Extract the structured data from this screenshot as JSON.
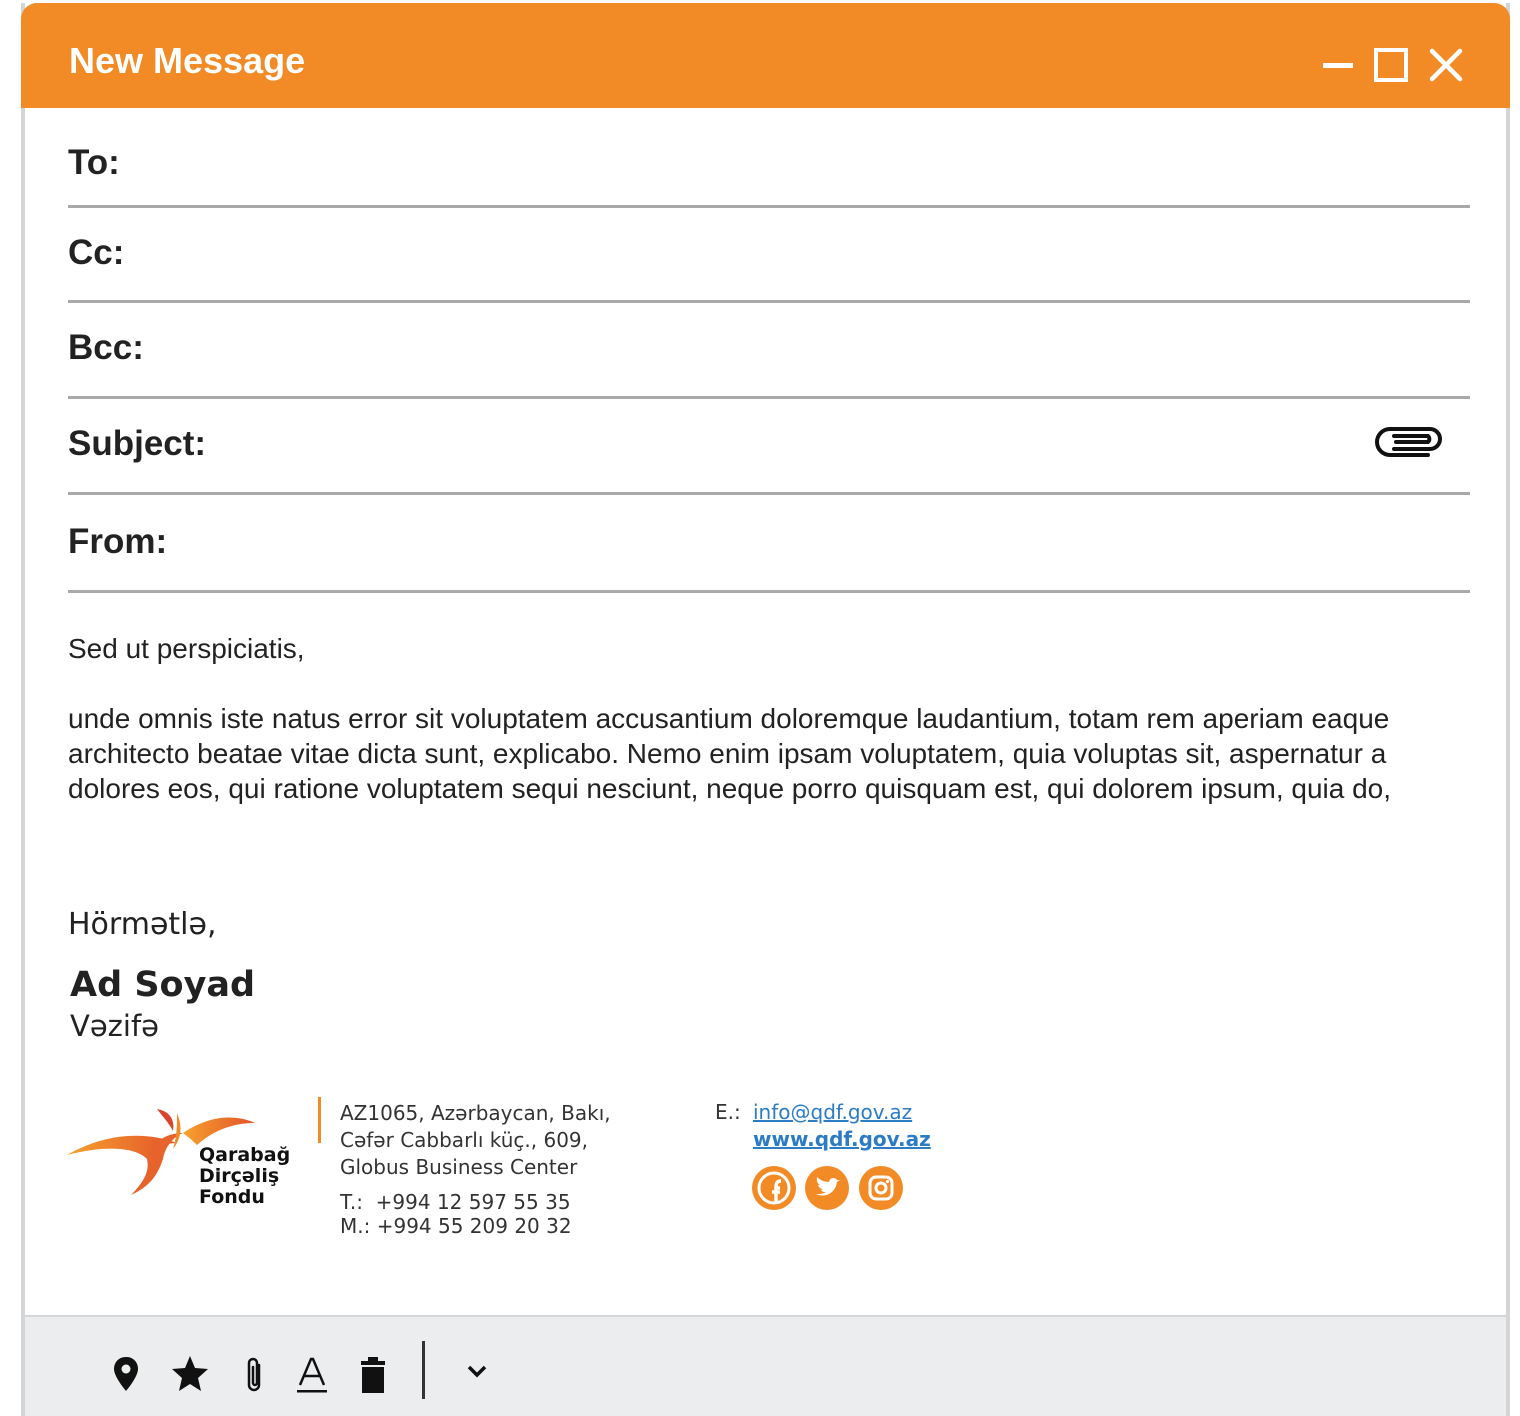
{
  "window": {
    "title": "New Message"
  },
  "fields": {
    "to_label": "To:",
    "cc_label": "Cc:",
    "bcc_label": "Bcc:",
    "subject_label": "Subject:",
    "from_label": "From:"
  },
  "body": {
    "greeting": "Sed ut perspiciatis,",
    "line1": "unde omnis iste natus error sit voluptatem accusantium doloremque laudantium, totam rem aperiam eaque",
    "line2": "architecto beatae vitae dicta sunt, explicabo. Nemo enim ipsam voluptatem, quia voluptas sit, aspernatur a",
    "line3": "dolores eos, qui ratione voluptatem sequi nesciunt, neque porro quisquam est, qui dolorem ipsum, quia do,"
  },
  "signature": {
    "closing": "Hörmətlə,",
    "name": "Ad Soyad",
    "position": "Vəzifə",
    "logo": {
      "line1": "Qarabağ",
      "line2": "Dirçəliş",
      "line3": "Fondu"
    },
    "address": {
      "line1": "AZ1065, Azərbaycan, Bakı,",
      "line2": "Cəfər Cabbarlı küç., 609,",
      "line3": "Globus Business Center"
    },
    "phone": "T.:  +994 12 597 55 35",
    "mobile": "M.: +994 55 209 20 32",
    "email_label": "E.:",
    "email": "info@qdf.gov.az",
    "website": "www.qdf.gov.az",
    "social_icons": [
      "facebook-icon",
      "twitter-icon",
      "instagram-icon"
    ]
  },
  "toolbar": {
    "icons": [
      "location-pin-icon",
      "star-icon",
      "paperclip-icon",
      "text-format-icon",
      "trash-icon",
      "chevron-down-icon"
    ]
  },
  "colors": {
    "accent": "#f28b26",
    "link": "#2b7bc5",
    "footer_bg": "#ebedee"
  }
}
